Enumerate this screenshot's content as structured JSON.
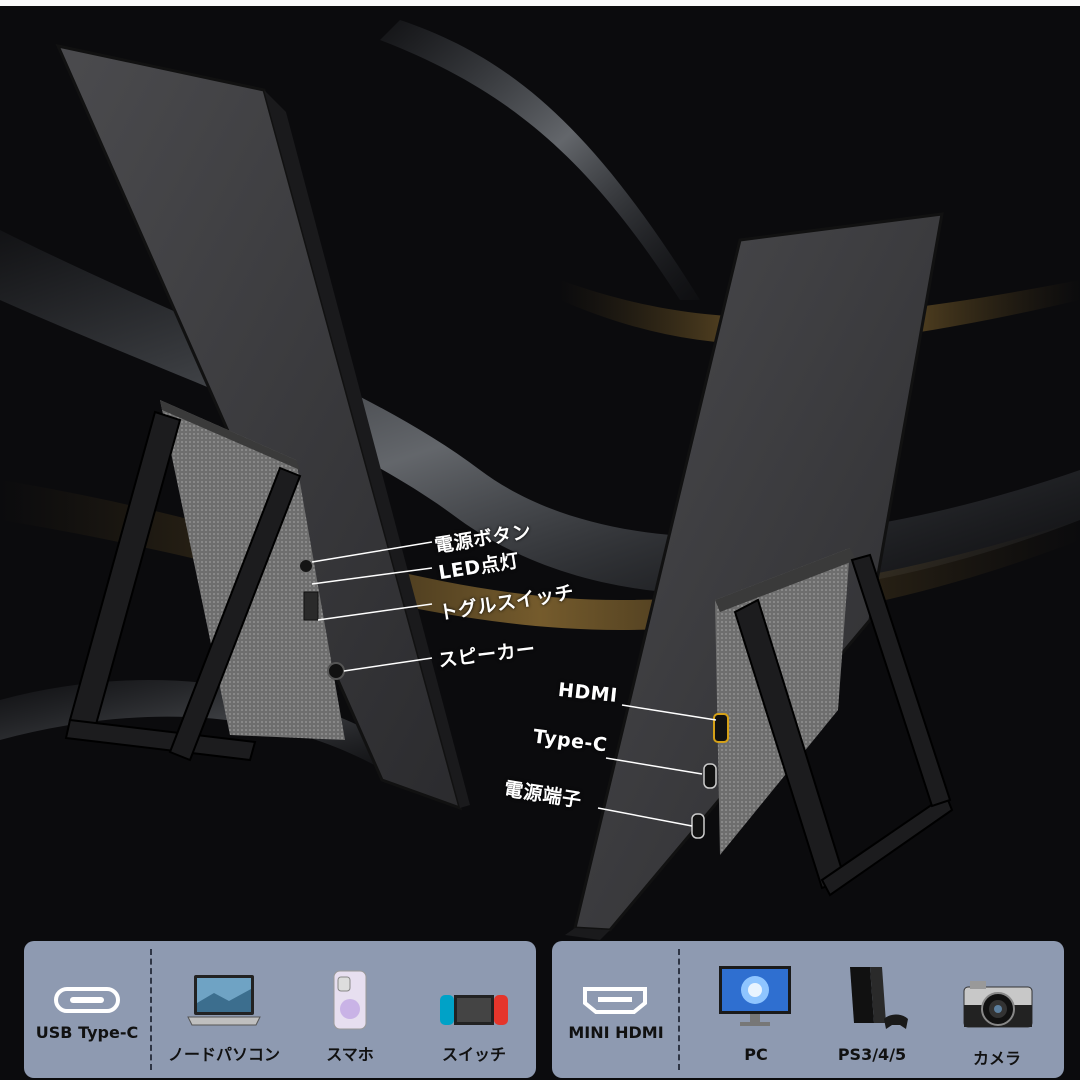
{
  "callouts": {
    "power_button": "電源ボタン",
    "led": "LED点灯",
    "toggle_switch": "トグルスイッチ",
    "speaker": "スピーカー",
    "hdmi": "HDMI",
    "type_c": "Type-C",
    "power_port": "電源端子"
  },
  "left_panel": {
    "connector": "USB Type-C",
    "devices": [
      "ノードパソコン",
      "スマホ",
      "スイッチ"
    ]
  },
  "right_panel": {
    "connector": "MINI HDMI",
    "devices": [
      "PC",
      "PS3/4/5",
      "カメラ"
    ]
  },
  "colors": {
    "panel": "#8e9ab1",
    "background": "#0b0b0d",
    "hdmi_port_accent": "#d4a017"
  },
  "icons": [
    "usb-type-c-icon",
    "laptop-icon",
    "smartphone-icon",
    "game-switch-icon",
    "mini-hdmi-icon",
    "monitor-icon",
    "console-icon",
    "camera-icon"
  ]
}
